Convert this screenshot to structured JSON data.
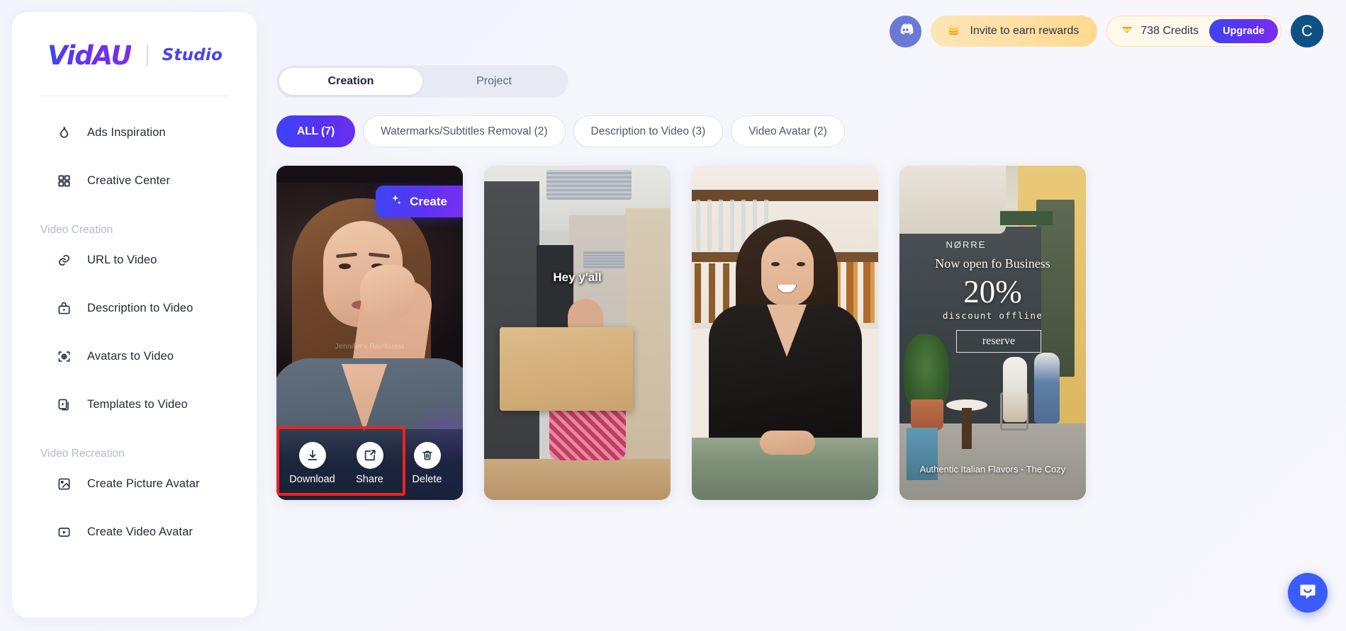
{
  "brand": {
    "logo": "VidAU",
    "sub": "Studio"
  },
  "sidebar": {
    "top_items": [
      {
        "label": "Ads Inspiration",
        "icon": "flame-icon"
      },
      {
        "label": "Creative Center",
        "icon": "grid-icon"
      }
    ],
    "sections": [
      {
        "title": "Video Creation",
        "items": [
          {
            "label": "URL to Video",
            "icon": "link-icon"
          },
          {
            "label": "Description to Video",
            "icon": "play-bag-icon"
          },
          {
            "label": "Avatars to Video",
            "icon": "target-avatar-icon"
          },
          {
            "label": "Templates to Video",
            "icon": "templates-icon"
          }
        ]
      },
      {
        "title": "Video Recreation",
        "items": [
          {
            "label": "Create Picture Avatar",
            "icon": "image-icon"
          },
          {
            "label": "Create Video Avatar",
            "icon": "video-icon"
          }
        ]
      }
    ]
  },
  "header": {
    "discord_label": "discord-icon",
    "invite_label": "Invite to earn rewards",
    "invite_icon": "coins-icon",
    "credits_label": "738 Credits",
    "credits_icon": "gem-icon",
    "upgrade_label": "Upgrade",
    "avatar_initial": "C"
  },
  "main": {
    "tabs": [
      {
        "label": "Creation",
        "active": true
      },
      {
        "label": "Project",
        "active": false
      }
    ],
    "filters": [
      {
        "label": "ALL (7)",
        "active": true
      },
      {
        "label": "Watermarks/Subtitles Removal (2)",
        "active": false
      },
      {
        "label": "Description to Video (3)",
        "active": false
      },
      {
        "label": "Video Avatar (2)",
        "active": false
      }
    ],
    "create_button": "Create",
    "actions": [
      {
        "label": "Download",
        "icon": "download-icon"
      },
      {
        "label": "Share",
        "icon": "share-icon"
      },
      {
        "label": "Delete",
        "icon": "trash-icon"
      }
    ],
    "cards": [
      {
        "watermark": "Jennifer's Rainforest"
      },
      {
        "caption": "Hey y'all"
      },
      {
        "caption": ""
      },
      {
        "sign": "NØRRE",
        "headline": "Now open fo Business",
        "percent": "20%",
        "sub": "discount offline",
        "cta": "reserve",
        "caption": "Authentic Italian Flavors - The Cozy"
      }
    ]
  },
  "chat": {
    "icon": "intercom-chat-icon"
  },
  "colors": {
    "accent": "#4a43ef",
    "accent_gradient_start": "#3d44f5",
    "accent_gradient_end": "#7c2ef0",
    "highlight_box": "#ee2222",
    "credits_bg": "#fff9ec",
    "invite_bg": "#ffdfa6",
    "avatar_bg": "#0d5186",
    "chat_bg": "#3b5bfd"
  }
}
